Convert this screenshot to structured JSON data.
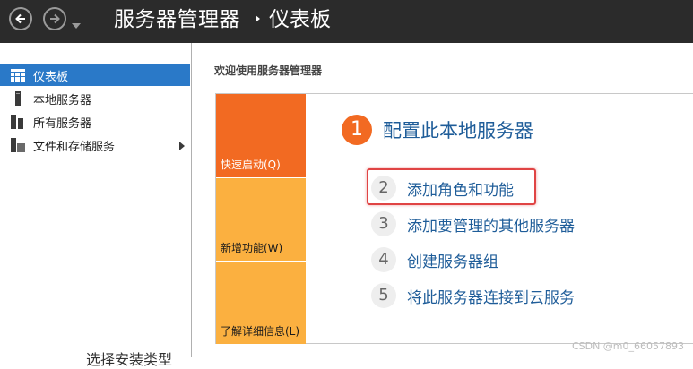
{
  "titlebar": {
    "app_title": "服务器管理器",
    "separator": "▸",
    "page_title": "仪表板"
  },
  "sidebar": {
    "items": [
      {
        "label": "仪表板",
        "icon": "dashboard-icon",
        "active": true
      },
      {
        "label": "本地服务器",
        "icon": "server-icon",
        "active": false
      },
      {
        "label": "所有服务器",
        "icon": "servers-icon",
        "active": false
      },
      {
        "label": "文件和存储服务",
        "icon": "storage-icon",
        "active": false,
        "has_submenu": true
      }
    ]
  },
  "main": {
    "welcome": "欢迎使用服务器管理器",
    "tiles": {
      "quick_start": "快速启动(Q)",
      "whats_new": "新增功能(W)",
      "learn_more": "了解详细信息(L)"
    },
    "steps": [
      {
        "num": "1",
        "label": "配置此本地服务器"
      },
      {
        "num": "2",
        "label": "添加角色和功能"
      },
      {
        "num": "3",
        "label": "添加要管理的其他服务器"
      },
      {
        "num": "4",
        "label": "创建服务器组"
      },
      {
        "num": "5",
        "label": "将此服务器连接到云服务"
      }
    ],
    "peek_text": "选择安装类型"
  },
  "watermark": "CSDN @m0_66057893",
  "colors": {
    "titlebar": "#2b2b2b",
    "accent_blue": "#2a79c8",
    "tile_orange": "#f26a22",
    "tile_yellow": "#fbb040",
    "link": "#1f5d99",
    "highlight": "#e04444"
  }
}
